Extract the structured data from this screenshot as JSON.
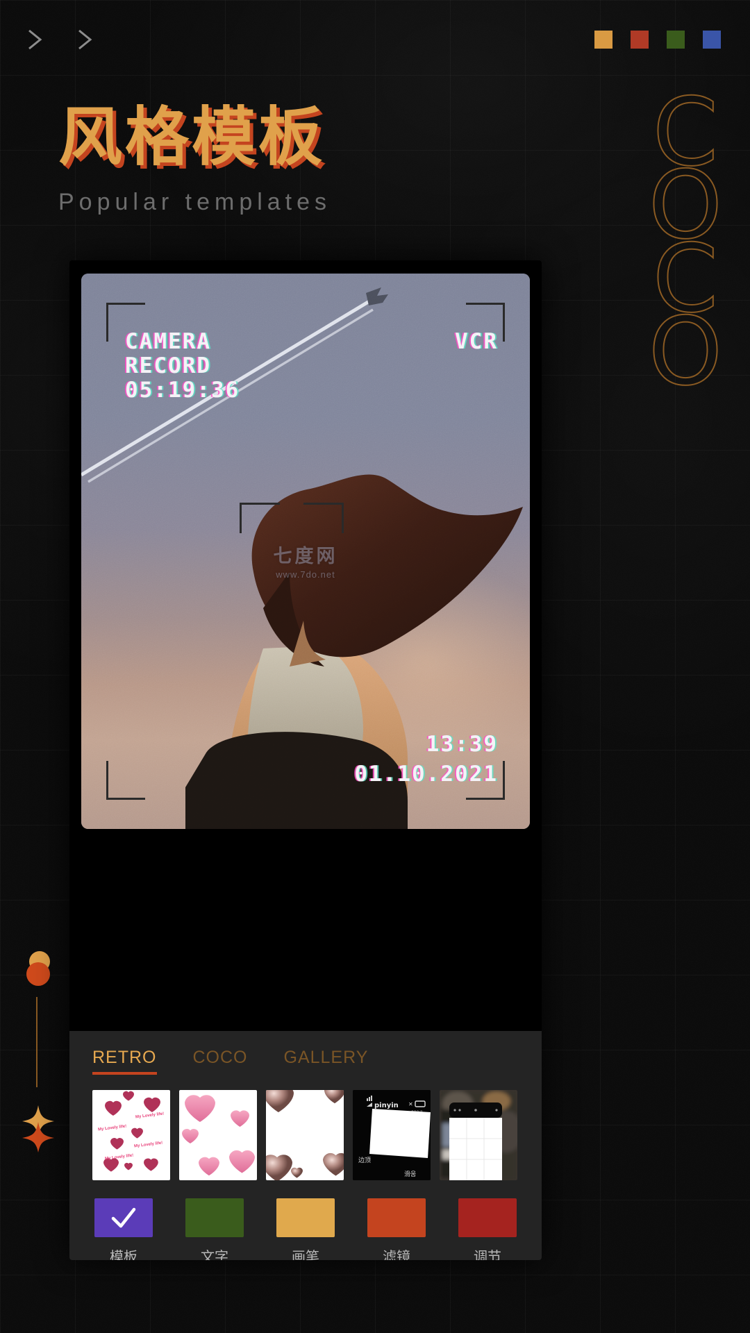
{
  "header": {
    "nav_icons": [
      "chevron-right-icon",
      "chevron-right-icon"
    ],
    "swatches": [
      {
        "name": "swatch-orange",
        "color": "#d99a43"
      },
      {
        "name": "swatch-red",
        "color": "#b03a26"
      },
      {
        "name": "swatch-green",
        "color": "#3a5c1c"
      },
      {
        "name": "swatch-blue",
        "color": "#3a55a8"
      }
    ]
  },
  "hero": {
    "title_cn": "风格模板",
    "title_en": "Popular templates",
    "title_color": "#e0a14b",
    "title_shadow_color": "#c4441f",
    "subtitle_color": "#6d6d6d",
    "side_letters": [
      "C",
      "O",
      "C",
      "O"
    ],
    "side_letters_color": "#8a5a22"
  },
  "decorations": {
    "circle_top_color": "#e0a14b",
    "circle_bottom_color": "#cf4a1c",
    "line_color": "#8a5a22",
    "spark_top_color": "#e0a14b",
    "spark_bottom_color": "#cf4a1c"
  },
  "preview": {
    "overlay": {
      "label_camera": "CAMERA",
      "label_record": "RECORD",
      "timecode": "05:19:36",
      "label_mode": "VCR",
      "clock": "13:39",
      "date": "01.10.2021"
    },
    "watermark": {
      "text": "七度网",
      "url": "www.7do.net"
    }
  },
  "editor": {
    "tabs": [
      {
        "label": "RETRO",
        "active": true
      },
      {
        "label": "COCO",
        "active": false
      },
      {
        "label": "GALLERY",
        "active": false
      }
    ],
    "tab_active_color": "#e7a950",
    "tab_inactive_color": "#7a5526",
    "tab_underline_color": "#c4441f",
    "thumbnails": [
      {
        "name": "template-hearts-small",
        "style": "hearts-dark-pink"
      },
      {
        "name": "template-hearts-large",
        "style": "hearts-light-pink"
      },
      {
        "name": "template-hearts-3d",
        "style": "hearts-3d-corner"
      },
      {
        "name": "template-phone-pinyin",
        "style": "dark-phone-frame"
      },
      {
        "name": "template-phone-grid",
        "style": "blurred-phone-grid"
      }
    ],
    "tools": [
      {
        "label": "模板",
        "color": "#5b3cb8",
        "selected": true,
        "icon": "check-icon"
      },
      {
        "label": "文字",
        "color": "#3a5c1c",
        "selected": false,
        "icon": ""
      },
      {
        "label": "画笔",
        "color": "#e0a94d",
        "selected": false,
        "icon": ""
      },
      {
        "label": "滤镜",
        "color": "#c4441f",
        "selected": false,
        "icon": ""
      },
      {
        "label": "调节",
        "color": "#a5231f",
        "selected": false,
        "icon": ""
      }
    ],
    "tool_label_color": "#b9b9b9"
  }
}
